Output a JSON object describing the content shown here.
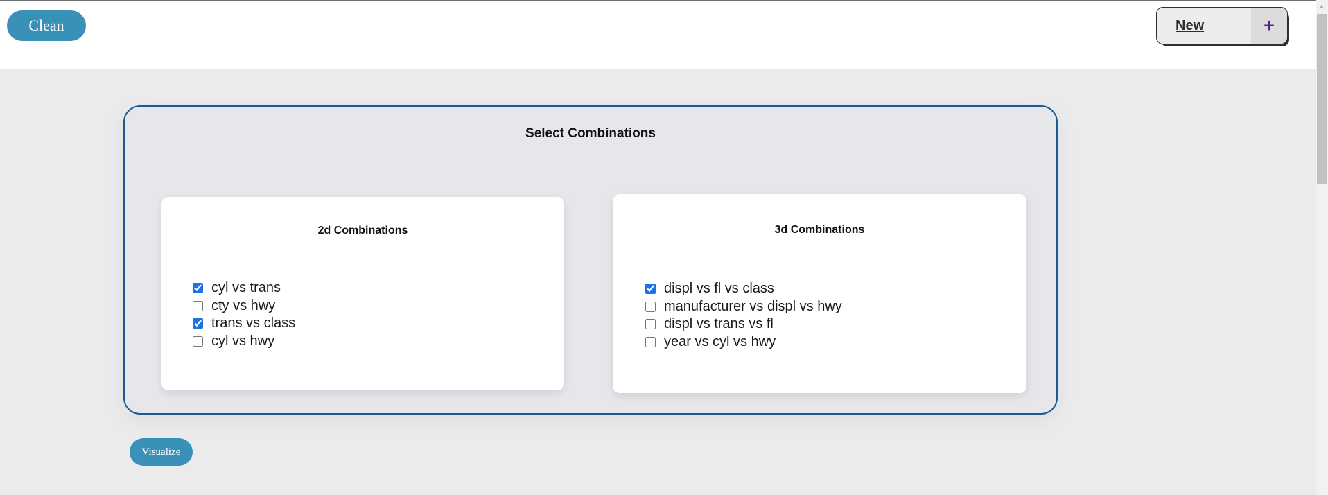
{
  "header": {
    "clean_label": "Clean",
    "new_label": "New",
    "new_icon": "plus-icon",
    "new_icon_glyph": "+"
  },
  "panel": {
    "title": "Select Combinations",
    "card_2d": {
      "title": "2d Combinations",
      "options": [
        {
          "label": "cyl vs trans",
          "checked": true
        },
        {
          "label": "cty vs hwy",
          "checked": false
        },
        {
          "label": "trans vs class",
          "checked": true
        },
        {
          "label": "cyl vs hwy",
          "checked": false
        }
      ]
    },
    "card_3d": {
      "title": "3d Combinations",
      "options": [
        {
          "label": "displ vs fl vs class",
          "checked": true
        },
        {
          "label": "manufacturer vs displ vs hwy",
          "checked": false
        },
        {
          "label": "displ vs trans vs fl",
          "checked": false
        },
        {
          "label": "year vs cyl vs hwy",
          "checked": false
        }
      ]
    }
  },
  "footer": {
    "visualize_label": "Visualize"
  },
  "colors": {
    "accent": "#3a91b8",
    "panel_border": "#1d5a8f",
    "checkbox": "#1a73e8"
  }
}
